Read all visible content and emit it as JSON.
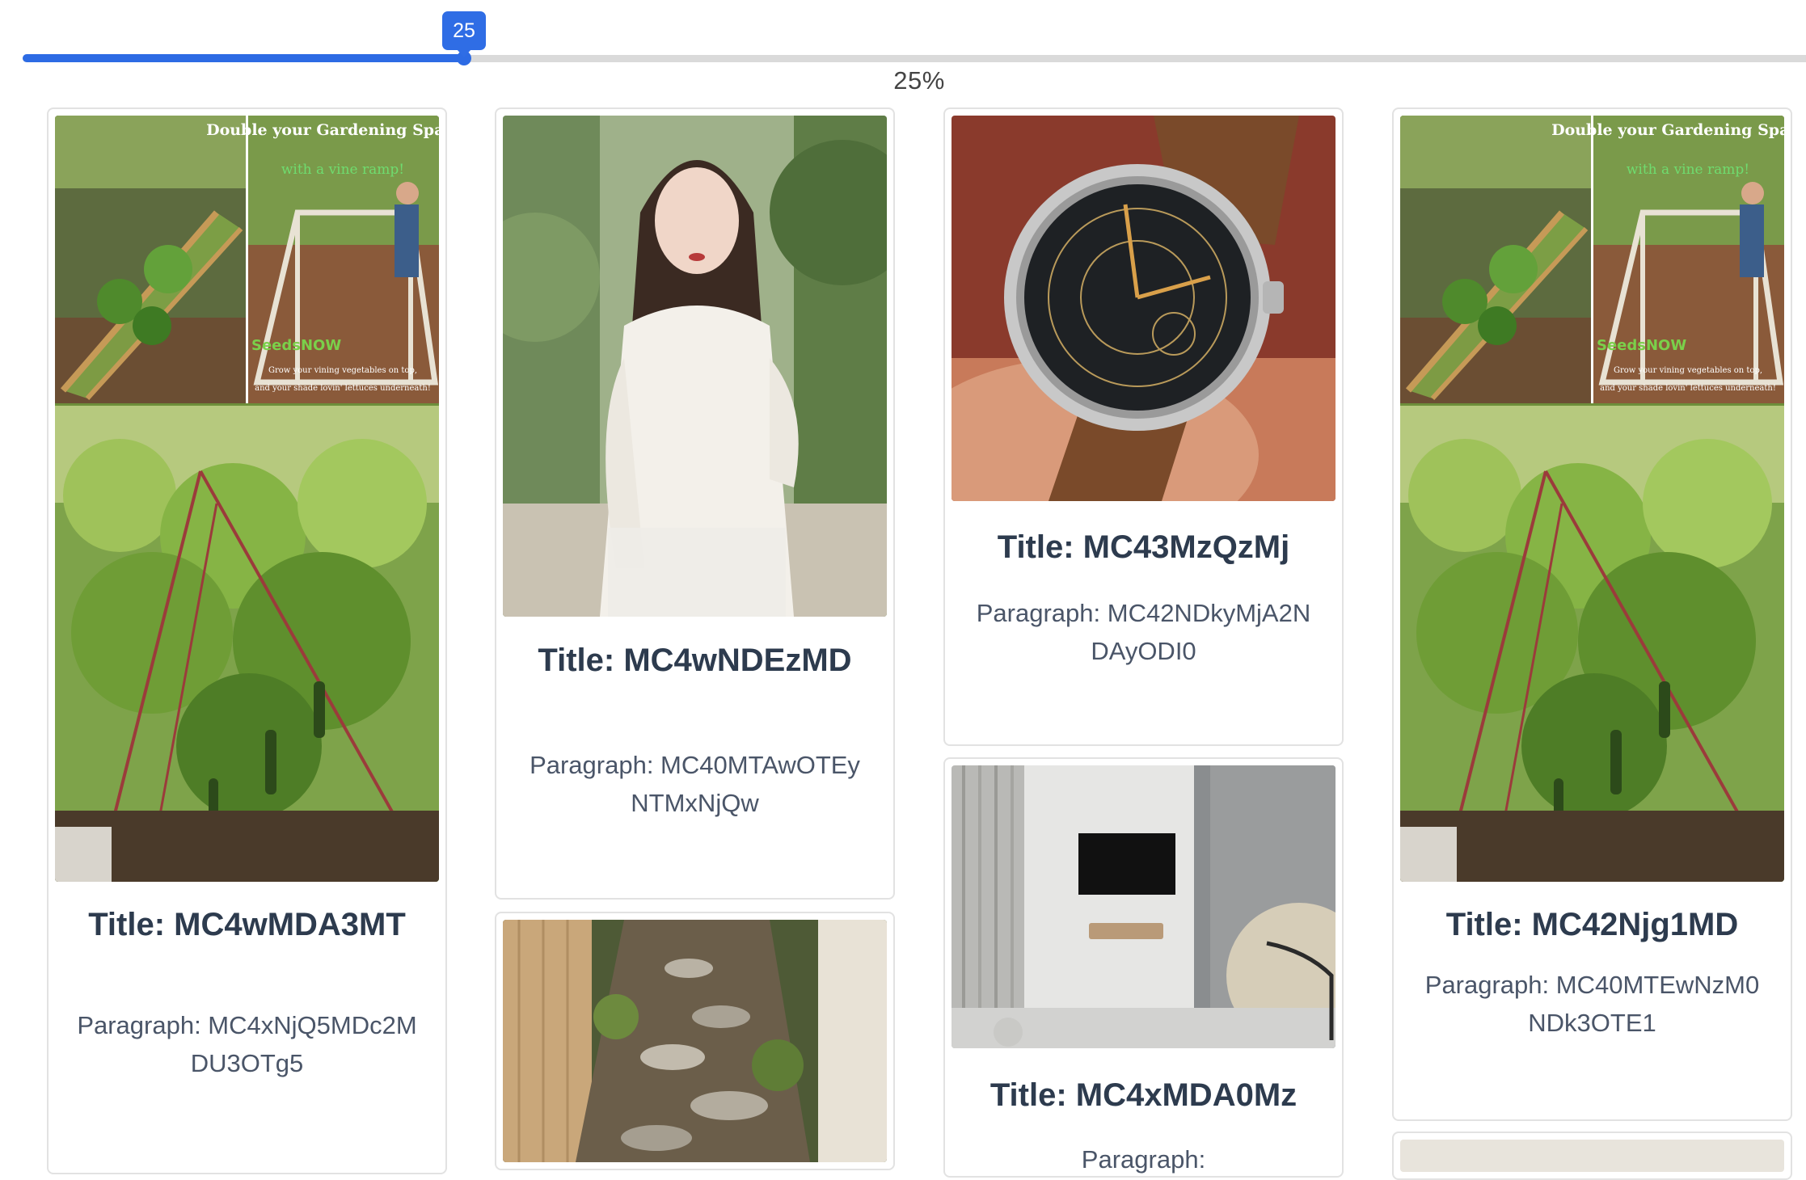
{
  "slider": {
    "value": 25,
    "value_label": "25",
    "percent_label": "25%",
    "colors": {
      "accent": "#2d6be4",
      "track": "#dadada"
    }
  },
  "cards": [
    {
      "title": "Title: MC4wMDA3MT",
      "paragraph": "Paragraph: MC4xNjQ5MDc2MDU3OTg5",
      "image": "garden-trellis-photo",
      "image_text": {
        "headline": "Double your Gardening Space...",
        "subline": "with a vine ramp!",
        "brand": "SeedsNOW",
        "caption1": "Grow your vining vegetables on top,",
        "caption2": "and your shade lovin' lettuces underneath!"
      }
    },
    {
      "title": "Title: MC4wNDEzMD",
      "paragraph": "Paragraph: MC40MTAwOTEyNTMxNjQw",
      "image": "woman-portrait-photo"
    },
    {
      "title": "Title: MC43MzQzMj",
      "paragraph": "Paragraph: MC42NDkyMjA2NDAyODI0",
      "image": "wristwatch-photo"
    },
    {
      "title": "Title: MC4xMDA0Mz",
      "paragraph": "Paragraph:",
      "image": "living-room-tv-photo"
    },
    {
      "title": "Title: MC42Njg1MD",
      "paragraph": "Paragraph: MC40MTEwNzM0NDk3OTE1",
      "image": "garden-trellis-photo",
      "image_text": {
        "headline": "Double your Gardening Space...",
        "subline": "with a vine ramp!",
        "brand": "SeedsNOW",
        "caption1": "Grow your vining vegetables on top,",
        "caption2": "and your shade lovin' lettuces underneath!"
      }
    },
    {
      "image": "garden-path-photo"
    }
  ]
}
